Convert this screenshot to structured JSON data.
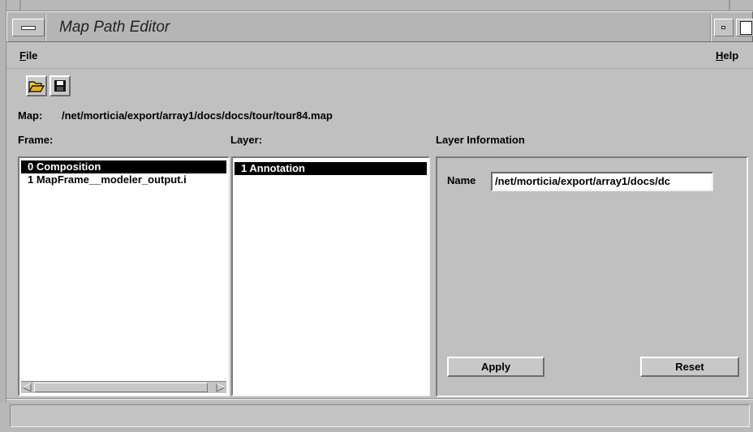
{
  "window": {
    "title": "Map Path Editor"
  },
  "menubar": {
    "file": {
      "mnemonic": "F",
      "rest": "ile"
    },
    "help": {
      "mnemonic": "H",
      "rest": "elp"
    }
  },
  "toolbar": {
    "open_icon": "open-folder-icon",
    "save_icon": "floppy-disk-icon"
  },
  "map": {
    "label": "Map:",
    "path": "/net/morticia/export/array1/docs/docs/tour/tour84.map"
  },
  "frame_list": {
    "label": "Frame:",
    "items": [
      {
        "label": "0 Composition",
        "selected": true
      },
      {
        "label": "1 MapFrame__modeler_output.i",
        "selected": false
      }
    ]
  },
  "layer_list": {
    "label": "Layer:",
    "items": [
      {
        "label": "1 Annotation",
        "selected": true
      }
    ]
  },
  "layer_info": {
    "label": "Layer Information",
    "name_label": "Name",
    "name_value": "/net/morticia/export/array1/docs/dc",
    "apply_label": "Apply",
    "reset_label": "Reset"
  },
  "statusbar": {
    "text": ""
  },
  "colors": {
    "window_bg": "#c0c0c0",
    "selection_bg": "#000000",
    "selection_fg": "#ffffff"
  }
}
